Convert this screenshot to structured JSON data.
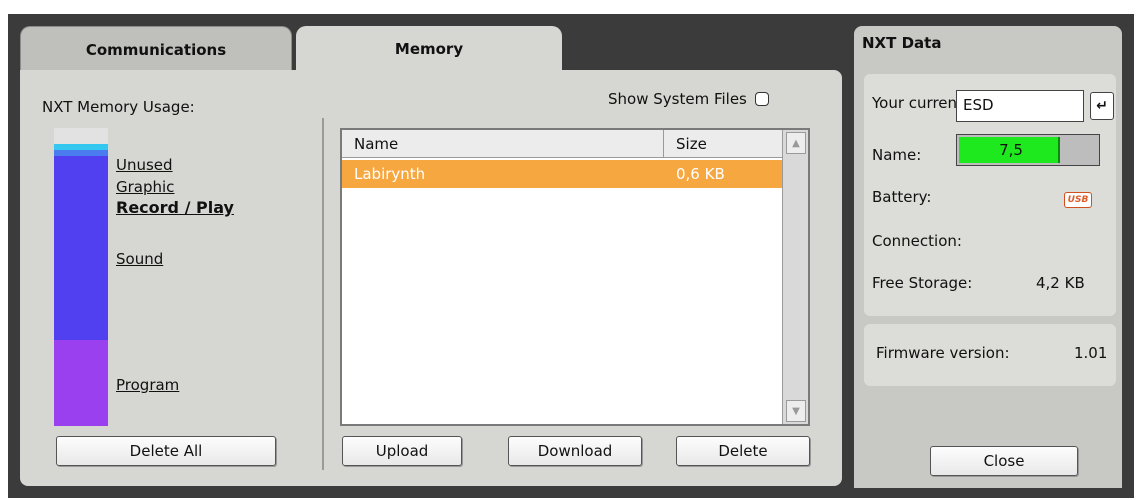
{
  "tabs": {
    "communications": "Communications",
    "memory": "Memory"
  },
  "memory": {
    "title": "NXT Memory Usage:",
    "legend": {
      "unused": "Unused",
      "graphic": "Graphic",
      "record_play": "Record / Play",
      "sound": "Sound",
      "program": "Program"
    },
    "bar_colors": {
      "unused": "#e2e2e2",
      "graphic": "#34c8f0",
      "record_play": "#4a7cf0",
      "sound": "#5040f0",
      "program": "#9a40ee"
    },
    "delete_all": "Delete All"
  },
  "files": {
    "show_system_files": "Show System Files",
    "show_system_files_checked": false,
    "columns": {
      "name": "Name",
      "size": "Size"
    },
    "rows": [
      {
        "name": "Labirynth",
        "size": "0,6 KB",
        "selected": true
      }
    ],
    "upload": "Upload",
    "download": "Download",
    "delete": "Delete"
  },
  "nxt": {
    "title": "NXT Data",
    "current_label": "Your current NXT is:",
    "name_label": "Name:",
    "name_value": "ESD",
    "battery_label": "Battery:",
    "battery_value": "7,5",
    "battery_level": 0.72,
    "connection_label": "Connection:",
    "connection_icon": "usb-icon",
    "connection_icon_text": "USB",
    "storage_label": "Free Storage:",
    "storage_value": "4,2 KB",
    "firmware_label": "Firmware version:",
    "firmware_value": "1.01",
    "close": "Close"
  }
}
